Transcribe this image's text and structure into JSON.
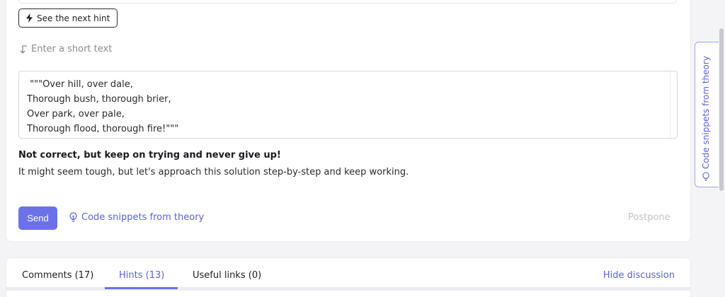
{
  "hint_button": {
    "label": "See the next hint",
    "icon": "lightning-icon"
  },
  "answer_field": {
    "placeholder": "Enter a short text",
    "icon": "arrow-down-return-icon",
    "lines": [
      " \"\"\"Over hill, over dale,",
      "Thorough bush, thorough brier,",
      "Over park, over pale,",
      "Thorough flood, thorough fire!\"\"\""
    ]
  },
  "feedback": {
    "title": "Not correct, but keep on trying and never give up!",
    "message": "It might seem tough, but let's approach this solution step-by-step and keep working."
  },
  "actions": {
    "send_label": "Send",
    "snippets_label": "Code snippets from theory",
    "postpone_label": "Postpone"
  },
  "tabs": [
    {
      "label": "Comments (17)",
      "active": false
    },
    {
      "label": "Hints (13)",
      "active": true
    },
    {
      "label": "Useful links (0)",
      "active": false
    }
  ],
  "hide_discussion_label": "Hide discussion",
  "side_panel": {
    "label": "Code snippets from theory"
  },
  "colors": {
    "accent": "#6b72e8",
    "link": "#5b62d6",
    "muted": "#c4c4ca"
  }
}
